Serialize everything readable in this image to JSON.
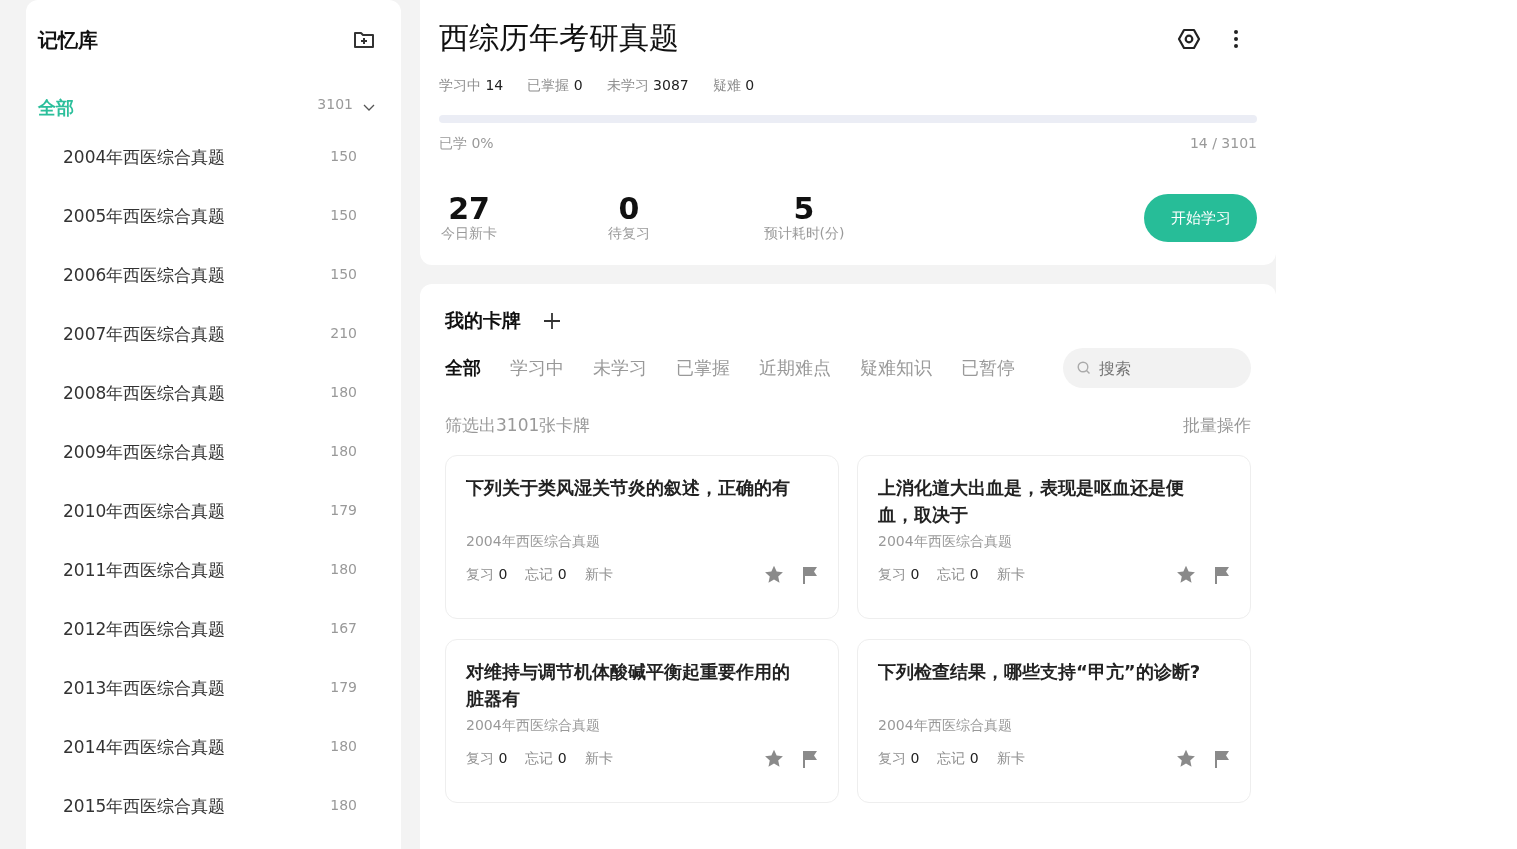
{
  "sidebar": {
    "title": "记忆库",
    "root": {
      "label": "全部",
      "count": "3101",
      "selected": true,
      "expanded": true,
      "children": [
        {
          "label": "2004年西医综合真题",
          "count": "150"
        },
        {
          "label": "2005年西医综合真题",
          "count": "150"
        },
        {
          "label": "2006年西医综合真题",
          "count": "150"
        },
        {
          "label": "2007年西医综合真题",
          "count": "210"
        },
        {
          "label": "2008年西医综合真题",
          "count": "180"
        },
        {
          "label": "2009年西医综合真题",
          "count": "180"
        },
        {
          "label": "2010年西医综合真题",
          "count": "179"
        },
        {
          "label": "2011年西医综合真题",
          "count": "180"
        },
        {
          "label": "2012年西医综合真题",
          "count": "167"
        },
        {
          "label": "2013年西医综合真题",
          "count": "179"
        },
        {
          "label": "2014年西医综合真题",
          "count": "180"
        },
        {
          "label": "2015年西医综合真题",
          "count": "180"
        }
      ]
    }
  },
  "deck": {
    "title": "西综历年考研真题",
    "stats": [
      {
        "label": "学习中",
        "value": "14"
      },
      {
        "label": "已掌握",
        "value": "0"
      },
      {
        "label": "未学习",
        "value": "3087"
      },
      {
        "label": "疑难",
        "value": "0"
      }
    ],
    "progress": {
      "label": "已学 0%",
      "count": "14 / 3101"
    },
    "summary": [
      {
        "value": "27",
        "label": "今日新卡"
      },
      {
        "value": "0",
        "label": "待复习"
      },
      {
        "value": "5",
        "label": "预计耗时(分)"
      }
    ],
    "start_button": "开始学习"
  },
  "cards_panel": {
    "title": "我的卡牌",
    "tabs": [
      {
        "label": "全部",
        "selected": true
      },
      {
        "label": "学习中",
        "selected": false
      },
      {
        "label": "未学习",
        "selected": false
      },
      {
        "label": "已掌握",
        "selected": false
      },
      {
        "label": "近期难点",
        "selected": false
      },
      {
        "label": "疑难知识",
        "selected": false
      },
      {
        "label": "已暂停",
        "selected": false
      }
    ],
    "search": {
      "placeholder": "搜索"
    },
    "filter_text": "筛选出3101张卡牌",
    "batch_action": "批量操作",
    "cards": [
      {
        "title": "下列关于类风湿关节炎的叙述，正确的有",
        "deck": "2004年西医综合真题",
        "review_label": "复习",
        "review": "0",
        "forget_label": "忘记",
        "forget": "0",
        "status": "新卡"
      },
      {
        "title": "上消化道大出血是，表现是呕血还是便血，取决于",
        "deck": "2004年西医综合真题",
        "review_label": "复习",
        "review": "0",
        "forget_label": "忘记",
        "forget": "0",
        "status": "新卡"
      },
      {
        "title": "对维持与调节机体酸碱平衡起重要作用的脏器有",
        "deck": "2004年西医综合真题",
        "review_label": "复习",
        "review": "0",
        "forget_label": "忘记",
        "forget": "0",
        "status": "新卡"
      },
      {
        "title": "下列检查结果，哪些支持“甲亢”的诊断?",
        "deck": "2004年西医综合真题",
        "review_label": "复习",
        "review": "0",
        "forget_label": "忘记",
        "forget": "0",
        "status": "新卡"
      }
    ]
  }
}
